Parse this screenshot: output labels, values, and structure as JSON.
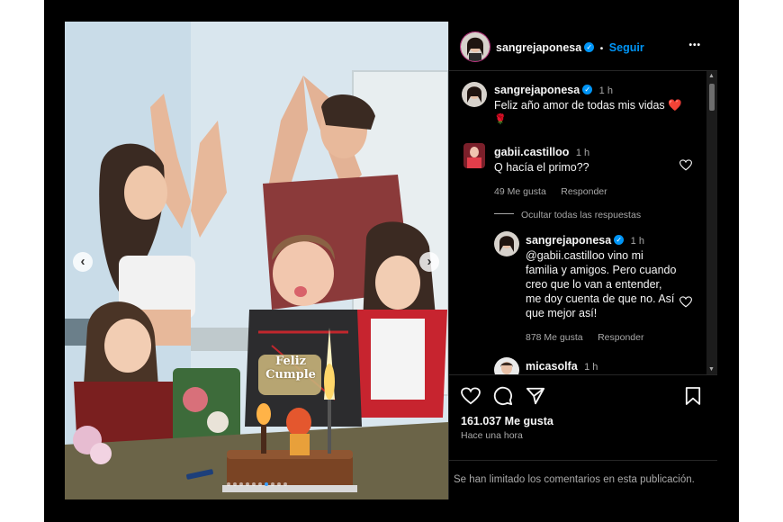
{
  "post_header": {
    "username": "sangrejaponesa",
    "separator": "•",
    "follow_label": "Seguir",
    "more_label": "•••"
  },
  "caption": {
    "username": "sangrejaponesa",
    "time": "1 h",
    "text": "Feliz año amor de todas mis vidas ❤️",
    "emoji_line": "🌹"
  },
  "comments": [
    {
      "username": "gabii.castilloo",
      "time": "1 h",
      "text": "Q hacía el primo??",
      "likes": "49 Me gusta",
      "reply_label": "Responder",
      "hide_replies": "Ocultar todas las respuestas"
    }
  ],
  "reply": {
    "username": "sangrejaponesa",
    "time": "1 h",
    "lines": [
      "@gabii.castilloo vino mi",
      "familia y amigos. Pero cuando",
      "creo que lo van a entender,",
      "me doy cuenta de que no. Así",
      "que mejor así!"
    ],
    "likes": "878 Me gusta",
    "reply_label": "Responder"
  },
  "partial_comment": {
    "username": "micasolfa",
    "time": "1 h"
  },
  "photo": {
    "cake_topper_line1": "Feliz",
    "cake_topper_line2": "Cumple",
    "prev_label": "‹",
    "next_label": "›"
  },
  "actions": {
    "likes_count": "161.037 Me gusta",
    "posted": "Hace una hora"
  },
  "footer": {
    "limited_text": "Se han limitado los comentarios en esta publicación."
  },
  "colors": {
    "link_blue": "#0095f6",
    "background": "#000000",
    "muted_text": "#a8a8a8"
  }
}
